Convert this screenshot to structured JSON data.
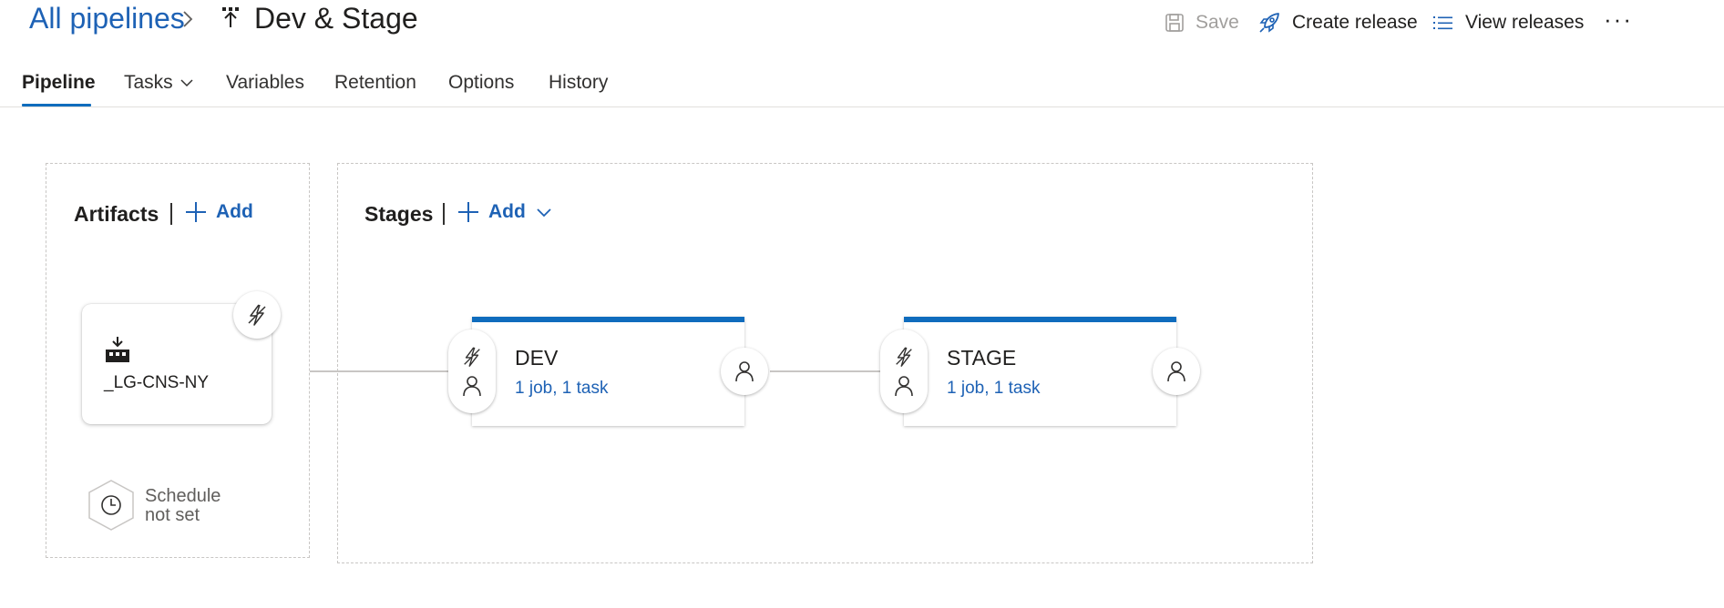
{
  "breadcrumb": {
    "root": "All pipelines",
    "title": "Dev & Stage"
  },
  "toolbar": {
    "save": "Save",
    "create_release": "Create release",
    "view_releases": "View releases",
    "more": "···"
  },
  "tabs": [
    {
      "label": "Pipeline",
      "active": true
    },
    {
      "label": "Tasks",
      "has_dropdown": true
    },
    {
      "label": "Variables"
    },
    {
      "label": "Retention"
    },
    {
      "label": "Options"
    },
    {
      "label": "History"
    }
  ],
  "artifacts": {
    "heading": "Artifacts",
    "add_label": "Add",
    "items": [
      {
        "name": "_LG-CNS-NY",
        "icon": "build-artifact-icon"
      }
    ],
    "schedule": {
      "line1": "Schedule",
      "line2": "not set"
    }
  },
  "stages": {
    "heading": "Stages",
    "add_label": "Add",
    "items": [
      {
        "name": "DEV",
        "summary": "1 job, 1 task"
      },
      {
        "name": "STAGE",
        "summary": "1 job, 1 task"
      }
    ]
  },
  "colors": {
    "accent": "#0f6cbd",
    "link": "#1e62b5",
    "disabled": "#a19f9d"
  }
}
